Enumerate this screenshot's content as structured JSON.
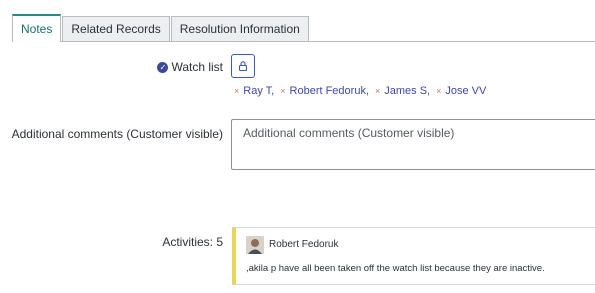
{
  "tabs": [
    {
      "label": "Notes",
      "active": true
    },
    {
      "label": "Related Records",
      "active": false
    },
    {
      "label": "Resolution Information",
      "active": false
    }
  ],
  "watch_list": {
    "label": "Watch list",
    "button_icon": "lock-icon",
    "watchers": [
      "Ray T,",
      "Robert Fedoruk,",
      "James S,",
      "Jose VV"
    ]
  },
  "comments": {
    "label": "Additional comments (Customer visible)",
    "placeholder": "Additional comments (Customer visible)"
  },
  "activities": {
    "label": "Activities: 5",
    "entries": [
      {
        "author": "Robert Fedoruk",
        "text": ",akila p have all been taken off the watch list because they are inactive."
      }
    ]
  },
  "colors": {
    "active_tab": "#2a8a86",
    "link": "#3d48a8",
    "remove_x": "#d6755c",
    "activity_accent": "#e8d65c"
  }
}
